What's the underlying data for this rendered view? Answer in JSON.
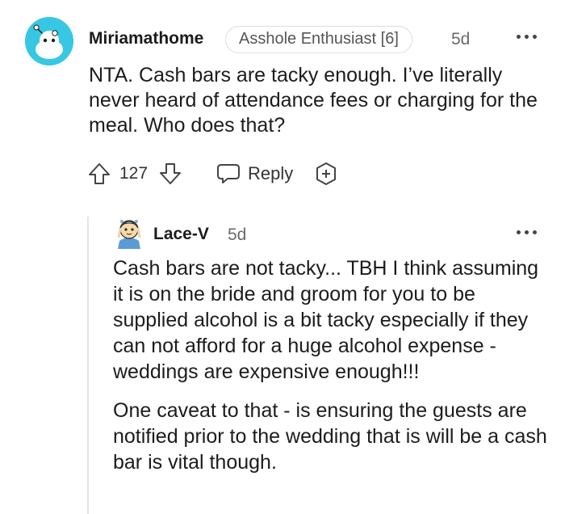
{
  "comment": {
    "avatar_icon": "snoo-avatar-icon",
    "username": "Miriamathome",
    "flair": "Asshole Enthusiast [6]",
    "time": "5d",
    "body": "NTA. Cash bars are tacky enough. I’ve literally never heard of attendance fees or charging for the meal. Who does that?",
    "score": "127",
    "reply_label": "Reply"
  },
  "reply": {
    "avatar_icon": "illustrated-avatar-icon",
    "username": "Lace-V",
    "time": "5d",
    "paragraphs": [
      "Cash bars are not tacky... TBH I think assuming it is on the bride and groom for you to be supplied alcohol is a bit tacky especially if they can not afford for a huge alcohol expense - weddings are expensive enough!!!",
      "One caveat to that - is ensuring the guests are notified prior to the wedding that is will be a cash bar is vital though."
    ]
  },
  "colors": {
    "avatar_bg": "#38c7e3",
    "text": "#1c1c1c",
    "muted": "#6a6a6a"
  }
}
